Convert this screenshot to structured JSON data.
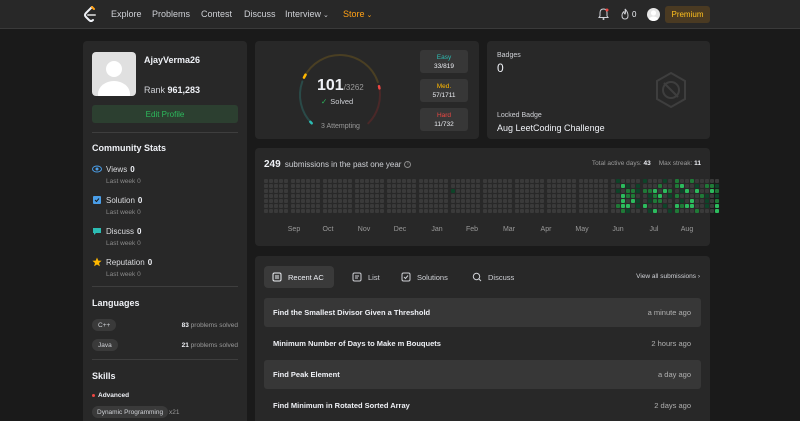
{
  "nav": {
    "items": [
      {
        "label": "Explore"
      },
      {
        "label": "Problems"
      },
      {
        "label": "Contest"
      },
      {
        "label": "Discuss"
      },
      {
        "label": "Interview"
      },
      {
        "label": "Store"
      }
    ],
    "streak_count": "0",
    "premium_label": "Premium"
  },
  "colors": {
    "accent": "#ffa116",
    "easy": "#2cbcb3",
    "medium": "#ffb800",
    "hard": "#ef4743",
    "green": "#2cbb5d"
  },
  "profile": {
    "username": "AjayVerma26",
    "rank_label": "Rank",
    "rank_value": "961,283",
    "edit_label": "Edit Profile"
  },
  "community": {
    "title": "Community Stats",
    "stats": [
      {
        "label": "Views",
        "value": "0",
        "sub": "Last week",
        "sub_value": "0",
        "icon": "eye-icon"
      },
      {
        "label": "Solution",
        "value": "0",
        "sub": "Last week",
        "sub_value": "0",
        "icon": "solution-icon"
      },
      {
        "label": "Discuss",
        "value": "0",
        "sub": "Last week",
        "sub_value": "0",
        "icon": "discuss-icon"
      },
      {
        "label": "Reputation",
        "value": "0",
        "sub": "Last week",
        "sub_value": "0",
        "icon": "star-icon"
      }
    ]
  },
  "languages": {
    "title": "Languages",
    "items": [
      {
        "name": "C++",
        "count": "83",
        "suffix": "problems solved"
      },
      {
        "name": "Java",
        "count": "21",
        "suffix": "problems solved"
      }
    ]
  },
  "skills": {
    "title": "Skills",
    "level": "Advanced",
    "items": [
      {
        "name": "Dynamic Programming",
        "count": "x21"
      }
    ]
  },
  "solved": {
    "count": "101",
    "total": "/3262",
    "label": "Solved",
    "attempting": "3 Attempting",
    "progress": {
      "easy": 33,
      "medium": 57,
      "hard": 11,
      "total": 3262
    },
    "difficulties": [
      {
        "name": "Easy",
        "value": "33/819"
      },
      {
        "name": "Med.",
        "value": "57/1711"
      },
      {
        "name": "Hard",
        "value": "11/732"
      }
    ]
  },
  "badges": {
    "title": "Badges",
    "count": "0",
    "locked_label": "Locked Badge",
    "locked_name": "Aug LeetCoding Challenge"
  },
  "submissions": {
    "count": "249",
    "label": "submissions in the past one year",
    "active_days_label": "Total active days:",
    "active_days": "43",
    "max_streak_label": "Max streak:",
    "max_streak": "11",
    "months": [
      "Sep",
      "Oct",
      "Nov",
      "Dec",
      "Jan",
      "Feb",
      "Mar",
      "Apr",
      "May",
      "Jun",
      "Jul",
      "Aug"
    ]
  },
  "recent": {
    "tabs": [
      {
        "label": "Recent AC",
        "icon": "recent-ac-icon"
      },
      {
        "label": "List",
        "icon": "list-icon"
      },
      {
        "label": "Solutions",
        "icon": "solutions-icon"
      },
      {
        "label": "Discuss",
        "icon": "discuss-search-icon"
      }
    ],
    "view_all": "View all submissions",
    "rows": [
      {
        "name": "Find the Smallest Divisor Given a Threshold",
        "time": "a minute ago"
      },
      {
        "name": "Minimum Number of Days to Make m Bouquets",
        "time": "2 hours ago"
      },
      {
        "name": "Find Peak Element",
        "time": "a day ago"
      },
      {
        "name": "Find Minimum in Rotated Sorted Array",
        "time": "2 days ago"
      }
    ]
  }
}
